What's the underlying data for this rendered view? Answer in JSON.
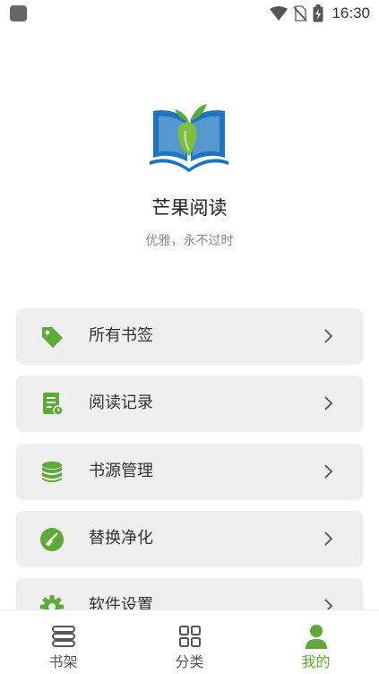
{
  "status_bar": {
    "time": "16:30"
  },
  "app": {
    "title": "芒果阅读",
    "slogan": "优雅，永不过时"
  },
  "menu": {
    "items": [
      {
        "label": "所有书签",
        "icon": "tag-icon"
      },
      {
        "label": "阅读记录",
        "icon": "reading-record-icon"
      },
      {
        "label": "书源管理",
        "icon": "database-icon"
      },
      {
        "label": "替换净化",
        "icon": "broom-icon"
      },
      {
        "label": "软件设置",
        "icon": "gear-icon"
      }
    ]
  },
  "bottom_nav": {
    "items": [
      {
        "label": "书架",
        "icon": "bookshelf-icon",
        "active": false
      },
      {
        "label": "分类",
        "icon": "grid-icon",
        "active": false
      },
      {
        "label": "我的",
        "icon": "person-icon",
        "active": true
      }
    ]
  },
  "colors": {
    "accent": "#5fa83a",
    "card_bg": "#efefef",
    "logo_blue": "#1f74bf"
  }
}
